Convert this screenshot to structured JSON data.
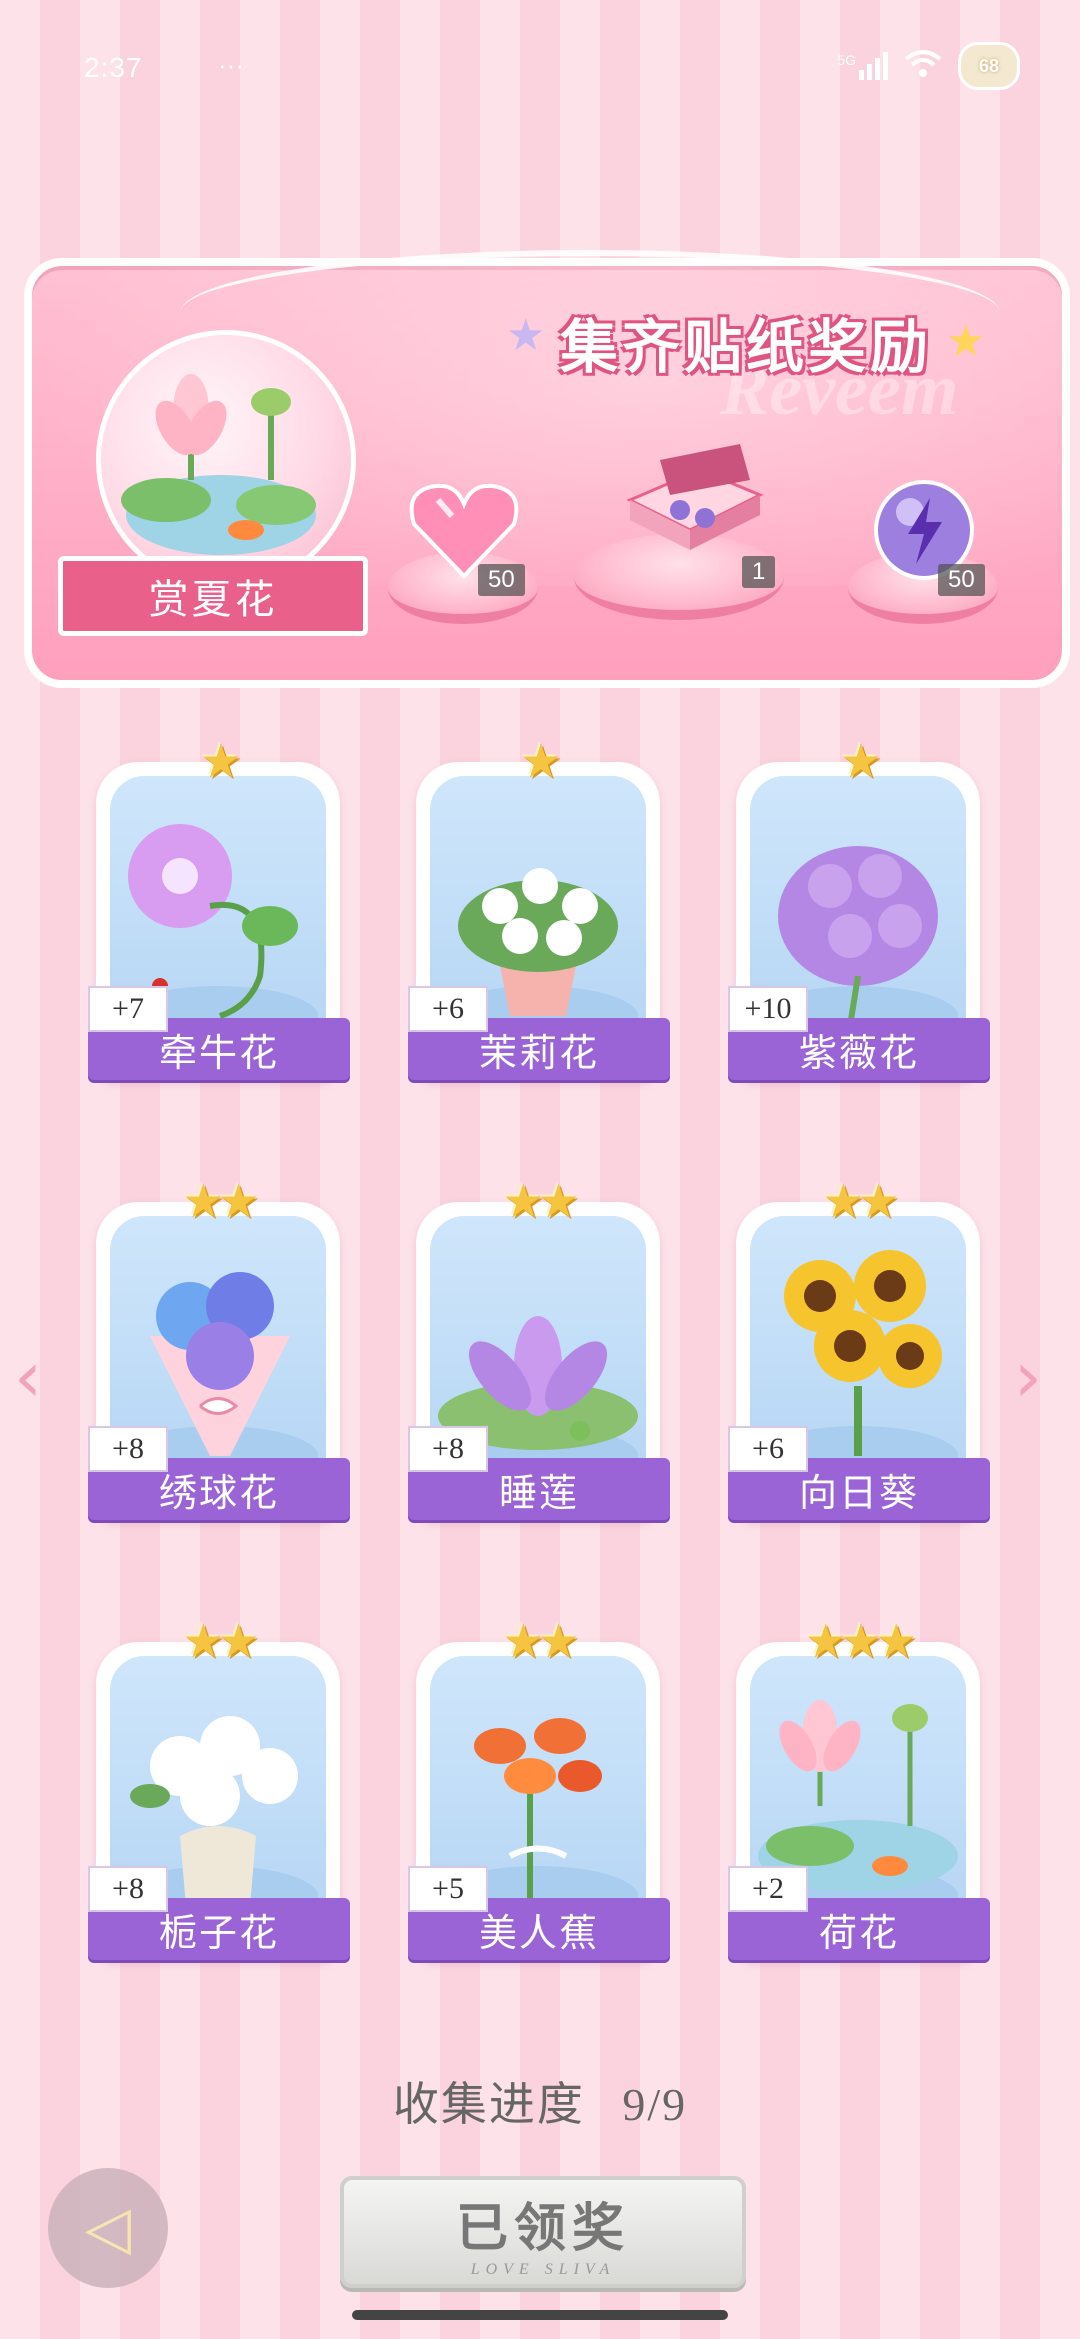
{
  "status_bar": {
    "time": "2:37",
    "extras": "···",
    "network": "5G",
    "battery": "68"
  },
  "banner": {
    "title": "集齐贴纸奖励",
    "bg_word": "Reveem",
    "set_name": "赏夏花",
    "rewards": [
      {
        "icon": "heart-gem-icon",
        "quantity": "50"
      },
      {
        "icon": "gift-box-icon",
        "quantity": "1"
      },
      {
        "icon": "energy-orb-icon",
        "quantity": "50"
      }
    ]
  },
  "cards": [
    {
      "name": "牵牛花",
      "bonus": "+7",
      "stars": 1,
      "icon": "morning-glory-icon"
    },
    {
      "name": "茉莉花",
      "bonus": "+6",
      "stars": 1,
      "icon": "jasmine-icon"
    },
    {
      "name": "紫薇花",
      "bonus": "+10",
      "stars": 1,
      "icon": "crape-myrtle-icon"
    },
    {
      "name": "绣球花",
      "bonus": "+8",
      "stars": 2,
      "icon": "hydrangea-icon"
    },
    {
      "name": "睡莲",
      "bonus": "+8",
      "stars": 2,
      "icon": "water-lily-icon"
    },
    {
      "name": "向日葵",
      "bonus": "+6",
      "stars": 2,
      "icon": "sunflower-icon"
    },
    {
      "name": "栀子花",
      "bonus": "+8",
      "stars": 2,
      "icon": "gardenia-icon"
    },
    {
      "name": "美人蕉",
      "bonus": "+5",
      "stars": 2,
      "icon": "canna-icon"
    },
    {
      "name": "荷花",
      "bonus": "+2",
      "stars": 3,
      "icon": "lotus-icon"
    }
  ],
  "progress": {
    "label": "收集进度",
    "value": "9/9"
  },
  "claim_button": {
    "label": "已领奖",
    "subtext": "LOVE SLIVA"
  },
  "colors": {
    "accent_purple": "#9a63d6",
    "pink_banner": "#ff9fbe",
    "star_gold": "#f5c542"
  }
}
